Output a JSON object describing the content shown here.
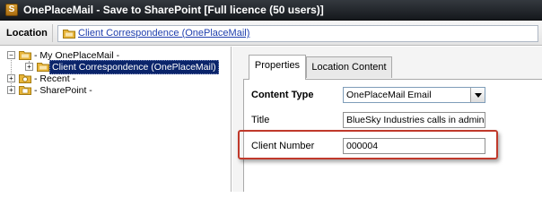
{
  "window": {
    "title": "OnePlaceMail - Save to SharePoint [Full licence (50 users)]",
    "app_icon_glyph": "S"
  },
  "location_bar": {
    "label": "Location",
    "path": "Client Correspondence (OnePlaceMail)"
  },
  "tree": {
    "items": [
      {
        "label": "- My OnePlaceMail -",
        "expander": "−"
      },
      {
        "label": "Client Correspondence (OnePlaceMail)",
        "expander": "+",
        "selected": true
      },
      {
        "label": "- Recent -",
        "expander": "+"
      },
      {
        "label": "- SharePoint -",
        "expander": "+"
      }
    ]
  },
  "tabs": [
    {
      "label": "Properties",
      "active": true
    },
    {
      "label": "Location Content",
      "active": false
    }
  ],
  "properties": {
    "content_type": {
      "label": "Content Type",
      "value": "OnePlaceMail Email"
    },
    "title": {
      "label": "Title",
      "value": "BlueSky Industries calls in administrato"
    },
    "client_number": {
      "label": "Client Number",
      "value": "000004"
    }
  },
  "colors": {
    "highlight": "#c0392b",
    "selection": "#0a246a",
    "link": "#1f3fae",
    "folder": "#e8b53a"
  }
}
